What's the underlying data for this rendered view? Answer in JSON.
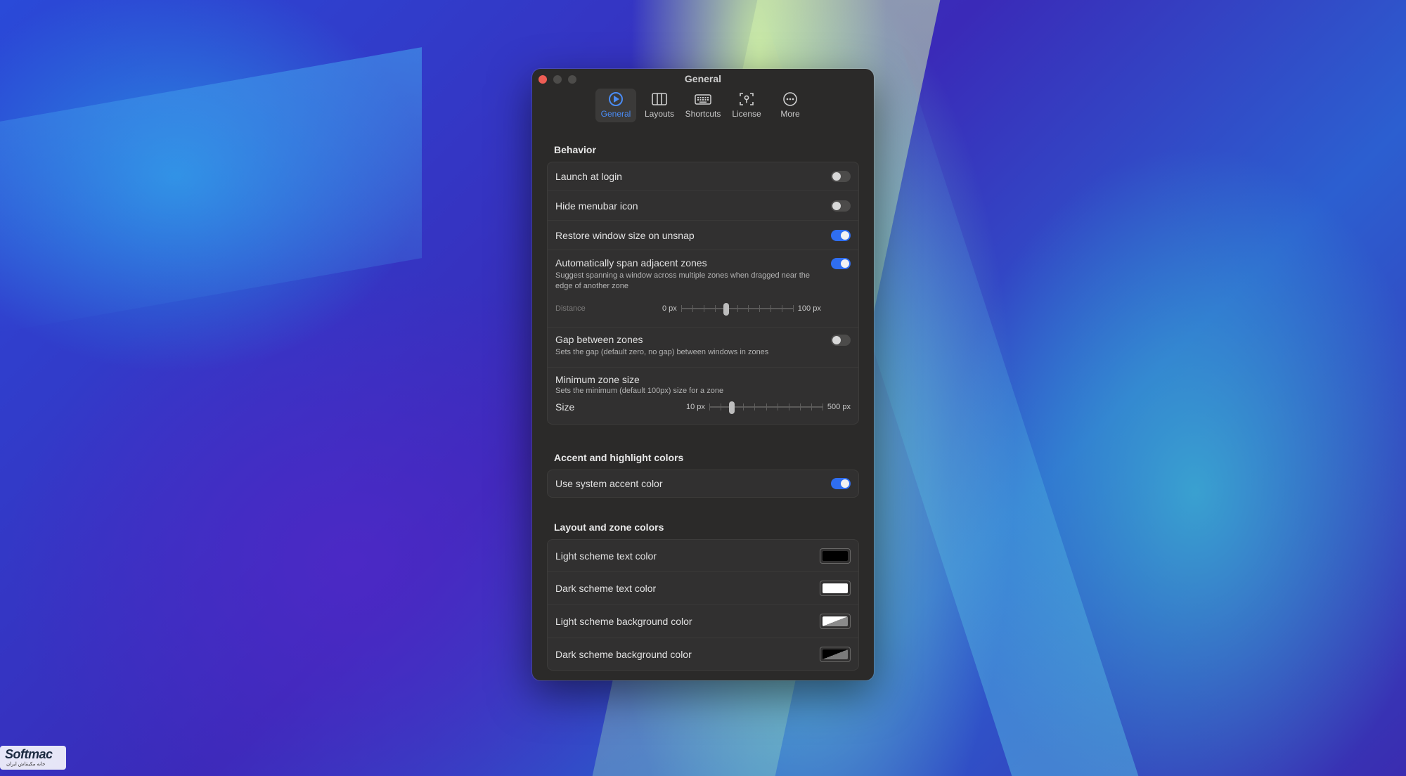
{
  "window": {
    "title": "General",
    "colors": {
      "accent": "#2f6ef0",
      "close": "#ee5d55",
      "background": "#2b2a29"
    }
  },
  "toolbar": {
    "tabs": [
      {
        "label": "General",
        "icon": "general-icon",
        "active": true
      },
      {
        "label": "Layouts",
        "icon": "layouts-icon",
        "active": false
      },
      {
        "label": "Shortcuts",
        "icon": "keyboard-icon",
        "active": false
      },
      {
        "label": "License",
        "icon": "license-icon",
        "active": false
      },
      {
        "label": "More",
        "icon": "more-icon",
        "active": false
      }
    ]
  },
  "behavior": {
    "title": "Behavior",
    "launch_at_login": {
      "label": "Launch at login",
      "on": false
    },
    "hide_menubar_icon": {
      "label": "Hide menubar icon",
      "on": false
    },
    "restore_window_size": {
      "label": "Restore window size on unsnap",
      "on": true
    },
    "span_zones": {
      "label": "Automatically span adjacent zones",
      "description": "Suggest spanning a window across multiple zones when dragged near the edge of another zone",
      "on": true,
      "distance": {
        "label": "Distance",
        "min": "0 px",
        "max": "100 px",
        "value_fraction": 0.4
      }
    },
    "gap_between_zones": {
      "label": "Gap between zones",
      "description": "Sets the gap (default zero, no gap) between windows in zones",
      "on": false
    },
    "minimum_zone_size": {
      "label": "Minimum zone size",
      "description": "Sets the minimum (default 100px) size for a zone",
      "size": {
        "label": "Size",
        "min": "10 px",
        "max": "500 px",
        "value_fraction": 0.2
      }
    }
  },
  "accent": {
    "title": "Accent and highlight colors",
    "use_system_accent": {
      "label": "Use system accent color",
      "on": true
    }
  },
  "zone_colors": {
    "title": "Layout and zone colors",
    "rows": [
      {
        "label": "Light scheme text color",
        "swatch": "#000000"
      },
      {
        "label": "Dark scheme text color",
        "swatch": "#ffffff"
      },
      {
        "label": "Light scheme background color",
        "swatch": "diagonal-white-gray"
      },
      {
        "label": "Dark scheme background color",
        "swatch": "diagonal-black-gray"
      }
    ]
  },
  "watermark": {
    "brand": "Softmac",
    "subtitle": "خانه مکینتاش ایران"
  }
}
